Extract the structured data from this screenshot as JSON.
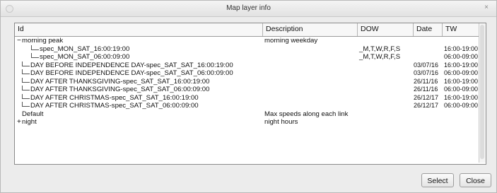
{
  "window": {
    "title": "Map layer info",
    "close_glyph": "×"
  },
  "table": {
    "columns": [
      "Id",
      "Description",
      "DOW",
      "Date",
      "TW"
    ],
    "rows": [
      {
        "level": 0,
        "toggle": "−",
        "id": "morning peak",
        "desc": "morning weekday",
        "dow": "",
        "date": "",
        "tw": ""
      },
      {
        "level": 2,
        "toggle": "",
        "id": "spec_MON_SAT_16:00:19:00",
        "desc": "",
        "dow": "_M,T,W,R,F,S",
        "date": "",
        "tw": "16:00-19:00"
      },
      {
        "level": 2,
        "toggle": "",
        "id": "spec_MON_SAT_06:00:09:00",
        "desc": "",
        "dow": "_M,T,W,R,F,S",
        "date": "",
        "tw": "06:00-09:00"
      },
      {
        "level": 1,
        "toggle": "",
        "id": "DAY BEFORE INDEPENDENCE DAY-spec_SAT_SAT_16:00:19:00",
        "desc": "",
        "dow": "",
        "date": "03/07/16",
        "tw": "16:00-19:00"
      },
      {
        "level": 1,
        "toggle": "",
        "id": "DAY BEFORE INDEPENDENCE DAY-spec_SAT_SAT_06:00:09:00",
        "desc": "",
        "dow": "",
        "date": "03/07/16",
        "tw": "06:00-09:00"
      },
      {
        "level": 1,
        "toggle": "",
        "id": "DAY AFTER THANKSGIVING-spec_SAT_SAT_16:00:19:00",
        "desc": "",
        "dow": "",
        "date": "26/11/16",
        "tw": "16:00-19:00"
      },
      {
        "level": 1,
        "toggle": "",
        "id": "DAY AFTER THANKSGIVING-spec_SAT_SAT_06:00:09:00",
        "desc": "",
        "dow": "",
        "date": "26/11/16",
        "tw": "06:00-09:00"
      },
      {
        "level": 1,
        "toggle": "",
        "id": "DAY AFTER CHRISTMAS-spec_SAT_SAT_16:00:19:00",
        "desc": "",
        "dow": "",
        "date": "26/12/17",
        "tw": "16:00-19:00"
      },
      {
        "level": 1,
        "toggle": "",
        "id": "DAY AFTER CHRISTMAS-spec_SAT_SAT_06:00:09:00",
        "desc": "",
        "dow": "",
        "date": "26/12/17",
        "tw": "06:00-09:00"
      },
      {
        "level": 0,
        "toggle": "",
        "id": "Default",
        "desc": "Max speeds along each link",
        "dow": "",
        "date": "",
        "tw": ""
      },
      {
        "level": 0,
        "toggle": "+",
        "id": "night",
        "desc": "night hours",
        "dow": "",
        "date": "",
        "tw": ""
      }
    ]
  },
  "buttons": {
    "select": "Select",
    "close": "Close"
  }
}
